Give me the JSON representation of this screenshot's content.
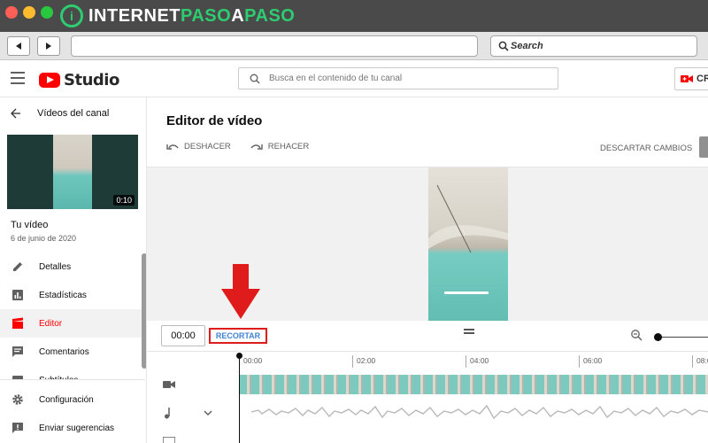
{
  "browser": {
    "brand_prefix": "INTERNET",
    "brand_highlight1": "PASO",
    "brand_middle": "A",
    "brand_highlight2": "PASO",
    "search_placeholder": "Search"
  },
  "header": {
    "logo_text": "Studio",
    "search_placeholder": "Busca en el contenido de tu canal",
    "create_label": "CR"
  },
  "sidebar": {
    "back_label": "Vídeos del canal",
    "thumbnail_duration": "0:10",
    "video_title": "Tu vídeo",
    "video_date": "6 de junio de 2020",
    "items": [
      {
        "label": "Detalles",
        "icon": "pencil-icon"
      },
      {
        "label": "Estadísticas",
        "icon": "analytics-icon"
      },
      {
        "label": "Editor",
        "icon": "clapperboard-icon",
        "active": true
      },
      {
        "label": "Comentarios",
        "icon": "comment-icon"
      },
      {
        "label": "Subtítulos",
        "icon": "subtitles-icon"
      }
    ],
    "bottom_items": [
      {
        "label": "Configuración",
        "icon": "gear-icon"
      },
      {
        "label": "Enviar sugerencias",
        "icon": "feedback-icon"
      }
    ]
  },
  "editor": {
    "title": "Editor de vídeo",
    "undo_label": "DESHACER",
    "redo_label": "REHACER",
    "discard_label": "DESCARTAR CAMBIOS",
    "current_time": "00:00",
    "trim_label": "RECORTAR",
    "ruler_ticks": [
      "00:00",
      "02:00",
      "04:00",
      "06:00",
      "08:0"
    ]
  },
  "colors": {
    "accent_red": "#ff0000",
    "highlight_border": "#e01b1b",
    "link_blue": "#3e82d0",
    "brand_green": "#2ecc71"
  }
}
